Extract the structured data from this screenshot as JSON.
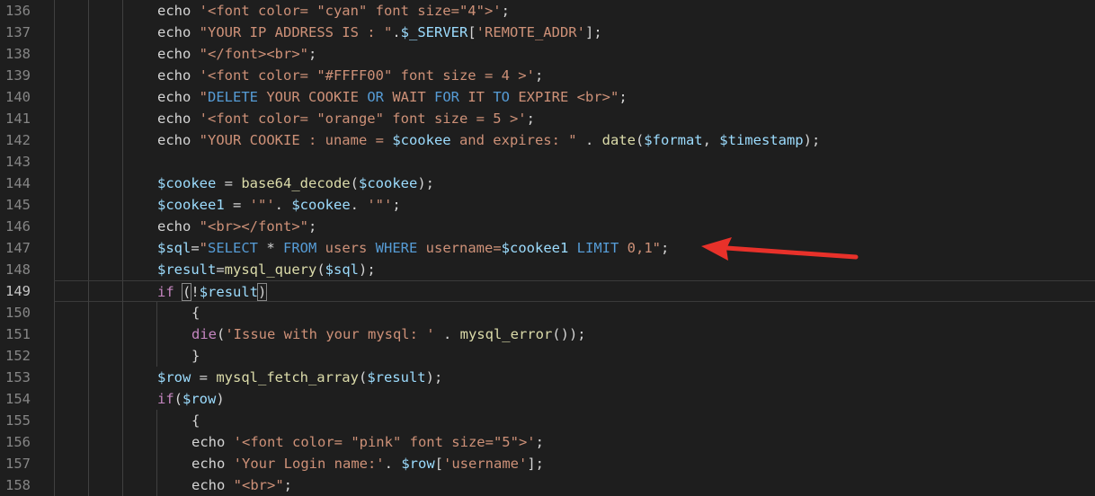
{
  "editor": {
    "lines": [
      {
        "num": "136",
        "segments": [
          {
            "t": "echo ",
            "c": "txt"
          },
          {
            "t": "'<font color= \"cyan\" font size=\"4\">'",
            "c": "str"
          },
          {
            "t": ";",
            "c": "txt"
          }
        ]
      },
      {
        "num": "137",
        "segments": [
          {
            "t": "echo ",
            "c": "txt"
          },
          {
            "t": "\"YOUR IP ADDRESS IS : \"",
            "c": "str"
          },
          {
            "t": ".",
            "c": "txt"
          },
          {
            "t": "$_SERVER",
            "c": "var"
          },
          {
            "t": "[",
            "c": "txt"
          },
          {
            "t": "'REMOTE_ADDR'",
            "c": "str"
          },
          {
            "t": "];",
            "c": "txt"
          }
        ]
      },
      {
        "num": "138",
        "segments": [
          {
            "t": "echo ",
            "c": "txt"
          },
          {
            "t": "\"</font><br>\"",
            "c": "str"
          },
          {
            "t": ";",
            "c": "txt"
          }
        ]
      },
      {
        "num": "139",
        "segments": [
          {
            "t": "echo ",
            "c": "txt"
          },
          {
            "t": "'<font color= \"#FFFF00\" font size = 4 >'",
            "c": "str"
          },
          {
            "t": ";",
            "c": "txt"
          }
        ]
      },
      {
        "num": "140",
        "segments": [
          {
            "t": "echo ",
            "c": "txt"
          },
          {
            "t": "\"",
            "c": "str"
          },
          {
            "t": "DELETE",
            "c": "blue"
          },
          {
            "t": " YOUR COOKIE ",
            "c": "str"
          },
          {
            "t": "OR",
            "c": "blue"
          },
          {
            "t": " WAIT ",
            "c": "str"
          },
          {
            "t": "FOR",
            "c": "blue"
          },
          {
            "t": " IT ",
            "c": "str"
          },
          {
            "t": "TO",
            "c": "blue"
          },
          {
            "t": " EXPIRE <br>\"",
            "c": "str"
          },
          {
            "t": ";",
            "c": "txt"
          }
        ]
      },
      {
        "num": "141",
        "segments": [
          {
            "t": "echo ",
            "c": "txt"
          },
          {
            "t": "'<font color= \"orange\" font size = 5 >'",
            "c": "str"
          },
          {
            "t": ";",
            "c": "txt"
          }
        ]
      },
      {
        "num": "142",
        "segments": [
          {
            "t": "echo ",
            "c": "txt"
          },
          {
            "t": "\"YOUR COOKIE : uname = ",
            "c": "str"
          },
          {
            "t": "$cookee",
            "c": "var"
          },
          {
            "t": " and expires: \"",
            "c": "str"
          },
          {
            "t": " . ",
            "c": "txt"
          },
          {
            "t": "date",
            "c": "fn"
          },
          {
            "t": "(",
            "c": "txt"
          },
          {
            "t": "$format",
            "c": "var"
          },
          {
            "t": ", ",
            "c": "txt"
          },
          {
            "t": "$timestamp",
            "c": "var"
          },
          {
            "t": ");",
            "c": "txt"
          }
        ]
      },
      {
        "num": "143",
        "segments": []
      },
      {
        "num": "144",
        "segments": [
          {
            "t": "$cookee",
            "c": "var"
          },
          {
            "t": " = ",
            "c": "txt"
          },
          {
            "t": "base64_decode",
            "c": "fn"
          },
          {
            "t": "(",
            "c": "txt"
          },
          {
            "t": "$cookee",
            "c": "var"
          },
          {
            "t": ");",
            "c": "txt"
          }
        ]
      },
      {
        "num": "145",
        "segments": [
          {
            "t": "$cookee1",
            "c": "var"
          },
          {
            "t": " = ",
            "c": "txt"
          },
          {
            "t": "'\"'",
            "c": "str"
          },
          {
            "t": ". ",
            "c": "txt"
          },
          {
            "t": "$cookee",
            "c": "var"
          },
          {
            "t": ". ",
            "c": "txt"
          },
          {
            "t": "'\"'",
            "c": "str"
          },
          {
            "t": ";",
            "c": "txt"
          }
        ]
      },
      {
        "num": "146",
        "segments": [
          {
            "t": "echo ",
            "c": "txt"
          },
          {
            "t": "\"<br></font>\"",
            "c": "str"
          },
          {
            "t": ";",
            "c": "txt"
          }
        ]
      },
      {
        "num": "147",
        "segments": [
          {
            "t": "$sql",
            "c": "var"
          },
          {
            "t": "=",
            "c": "txt"
          },
          {
            "t": "\"",
            "c": "str"
          },
          {
            "t": "SELECT",
            "c": "blue"
          },
          {
            "t": " * ",
            "c": "txt"
          },
          {
            "t": "FROM",
            "c": "blue"
          },
          {
            "t": " users ",
            "c": "str"
          },
          {
            "t": "WHERE",
            "c": "blue"
          },
          {
            "t": " username=",
            "c": "str"
          },
          {
            "t": "$cookee1",
            "c": "var"
          },
          {
            "t": " ",
            "c": "str"
          },
          {
            "t": "LIMIT",
            "c": "blue"
          },
          {
            "t": " 0,1\"",
            "c": "str"
          },
          {
            "t": ";",
            "c": "txt"
          }
        ]
      },
      {
        "num": "148",
        "segments": [
          {
            "t": "$result",
            "c": "var"
          },
          {
            "t": "=",
            "c": "txt"
          },
          {
            "t": "mysql_query",
            "c": "fn"
          },
          {
            "t": "(",
            "c": "txt"
          },
          {
            "t": "$sql",
            "c": "var"
          },
          {
            "t": ");",
            "c": "txt"
          }
        ]
      },
      {
        "num": "149",
        "current": true,
        "segments": [
          {
            "t": "if",
            "c": "kw"
          },
          {
            "t": " ",
            "c": "txt"
          },
          {
            "t": "(",
            "c": "txt",
            "hl": true
          },
          {
            "t": "!",
            "c": "txt"
          },
          {
            "t": "$result",
            "c": "var"
          },
          {
            "t": ")",
            "c": "txt",
            "hl": true
          }
        ]
      },
      {
        "num": "150",
        "indent": 2,
        "segments": [
          {
            "t": "{",
            "c": "txt"
          }
        ]
      },
      {
        "num": "151",
        "indent": 2,
        "segments": [
          {
            "t": "die",
            "c": "kw"
          },
          {
            "t": "(",
            "c": "txt"
          },
          {
            "t": "'Issue with your mysql: '",
            "c": "str"
          },
          {
            "t": " . ",
            "c": "txt"
          },
          {
            "t": "mysql_error",
            "c": "fn"
          },
          {
            "t": "());",
            "c": "txt"
          }
        ]
      },
      {
        "num": "152",
        "indent": 2,
        "segments": [
          {
            "t": "}",
            "c": "txt"
          }
        ]
      },
      {
        "num": "153",
        "segments": [
          {
            "t": "$row",
            "c": "var"
          },
          {
            "t": " = ",
            "c": "txt"
          },
          {
            "t": "mysql_fetch_array",
            "c": "fn"
          },
          {
            "t": "(",
            "c": "txt"
          },
          {
            "t": "$result",
            "c": "var"
          },
          {
            "t": ");",
            "c": "txt"
          }
        ]
      },
      {
        "num": "154",
        "segments": [
          {
            "t": "if",
            "c": "kw"
          },
          {
            "t": "(",
            "c": "txt"
          },
          {
            "t": "$row",
            "c": "var"
          },
          {
            "t": ")",
            "c": "txt"
          }
        ]
      },
      {
        "num": "155",
        "indent": 2,
        "segments": [
          {
            "t": "{",
            "c": "txt"
          }
        ]
      },
      {
        "num": "156",
        "indent": 2,
        "segments": [
          {
            "t": "echo ",
            "c": "txt"
          },
          {
            "t": "'<font color= \"pink\" font size=\"5\">'",
            "c": "str"
          },
          {
            "t": ";",
            "c": "txt"
          }
        ]
      },
      {
        "num": "157",
        "indent": 2,
        "segments": [
          {
            "t": "echo ",
            "c": "txt"
          },
          {
            "t": "'Your Login name:'",
            "c": "str"
          },
          {
            "t": ". ",
            "c": "txt"
          },
          {
            "t": "$row",
            "c": "var"
          },
          {
            "t": "[",
            "c": "txt"
          },
          {
            "t": "'username'",
            "c": "str"
          },
          {
            "t": "];",
            "c": "txt"
          }
        ]
      },
      {
        "num": "158",
        "indent": 2,
        "segments": [
          {
            "t": "echo ",
            "c": "txt"
          },
          {
            "t": "\"<br>\"",
            "c": "str"
          },
          {
            "t": ";",
            "c": "txt"
          }
        ]
      }
    ]
  },
  "annotation": {
    "arrow_color": "#e8312a",
    "arrow_icon": "red-arrow-pointing-left"
  }
}
